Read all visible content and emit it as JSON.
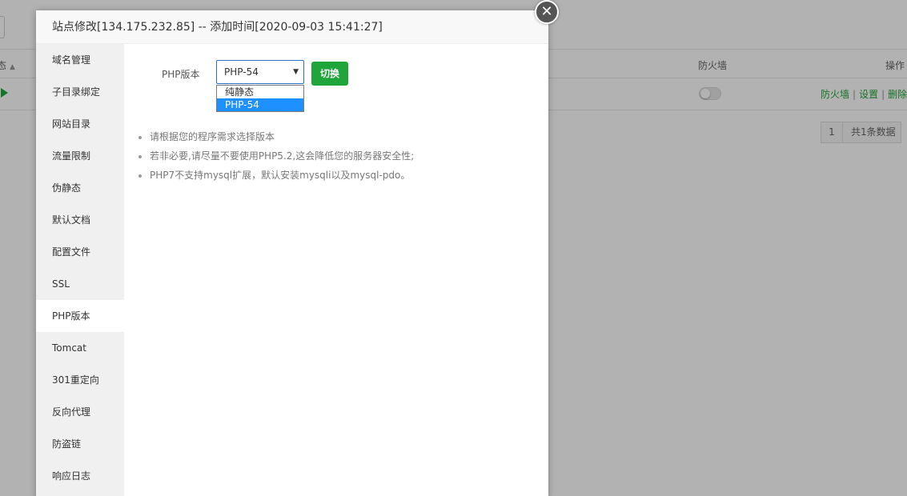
{
  "background": {
    "table": {
      "status_header": "态",
      "firewall_header": "防火墙",
      "ops_header": "操作"
    },
    "row": {
      "links": [
        "防火墙",
        "设置",
        "删除"
      ],
      "separator": "|"
    },
    "pager": {
      "page": "1",
      "total": "共1条数据"
    }
  },
  "modal": {
    "title": "站点修改[134.175.232.85] -- 添加时间[2020-09-03 15:41:27]",
    "close_glyph": "✕",
    "sidebar": [
      {
        "label": "域名管理",
        "active": false
      },
      {
        "label": "子目录绑定",
        "active": false
      },
      {
        "label": "网站目录",
        "active": false
      },
      {
        "label": "流量限制",
        "active": false
      },
      {
        "label": "伪静态",
        "active": false
      },
      {
        "label": "默认文档",
        "active": false
      },
      {
        "label": "配置文件",
        "active": false
      },
      {
        "label": "SSL",
        "active": false
      },
      {
        "label": "PHP版本",
        "active": true
      },
      {
        "label": "Tomcat",
        "active": false
      },
      {
        "label": "301重定向",
        "active": false
      },
      {
        "label": "反向代理",
        "active": false
      },
      {
        "label": "防盗链",
        "active": false
      },
      {
        "label": "响应日志",
        "active": false
      }
    ],
    "php": {
      "label": "PHP版本",
      "selected": "PHP-54",
      "options": [
        "纯静态",
        "PHP-54"
      ],
      "switch_label": "切换"
    },
    "tips": [
      "请根据您的程序需求选择版本",
      "若非必要,请尽量不要使用PHP5.2,这会降低您的服务器安全性;",
      "PHP7不支持mysql扩展，默认安装mysqli以及mysql-pdo。"
    ]
  },
  "colors": {
    "accent_green": "#20a53a",
    "select_border": "#2a6ec7",
    "dropdown_highlight": "#1e90ff"
  }
}
